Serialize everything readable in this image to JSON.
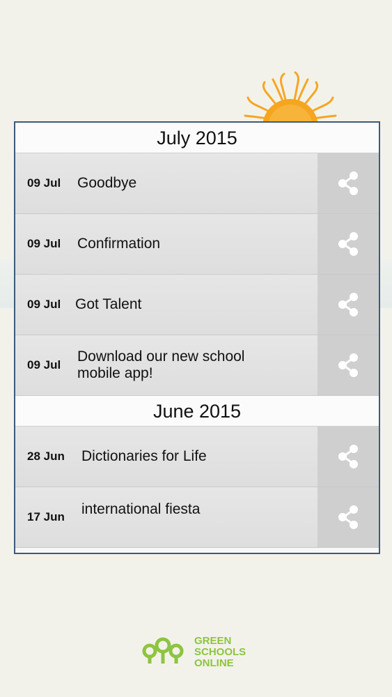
{
  "sections": [
    {
      "month": "July 2015",
      "items": [
        {
          "date": "09 Jul",
          "title": "Goodbye"
        },
        {
          "date": "09 Jul",
          "title": "Confirmation"
        },
        {
          "date": "09 Jul",
          "title": "Got Talent"
        },
        {
          "date": "09 Jul",
          "title": "Download our new school mobile app!"
        }
      ]
    },
    {
      "month": "June 2015",
      "items": [
        {
          "date": "28 Jun",
          "title": "Dictionaries for Life"
        },
        {
          "date": "17 Jun",
          "title": "international fiesta"
        }
      ]
    }
  ],
  "icons": {
    "share": "share-icon",
    "sun": "sun-illustration",
    "logo": "green-schools-online-logo"
  },
  "footer": {
    "logo_line1": "GREEN",
    "logo_line2": "SCHOOLS",
    "logo_line3": "ONLINE"
  },
  "colors": {
    "background": "#f3f2ea",
    "panel_border": "#3d5a78",
    "row_bg": "#e2e2e2",
    "share_bg": "#cfcfcf",
    "logo_green": "#8dc441",
    "sun_orange": "#f5a623"
  }
}
